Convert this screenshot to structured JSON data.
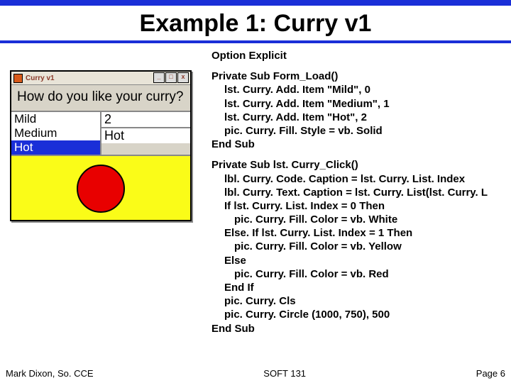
{
  "slide": {
    "title": "Example 1: Curry v1",
    "footer_left": "Mark Dixon, So. CCE",
    "footer_center": "SOFT 131",
    "footer_right": "Page 6"
  },
  "vbwindow": {
    "title": "Curry v1",
    "prompt": "How do you like your curry?",
    "list": {
      "i0": "Mild",
      "i1": "Medium",
      "i2": "Hot"
    },
    "selected_index": "2",
    "selected_text": "Hot",
    "controls": {
      "min": "_",
      "max": "□",
      "close": "x"
    }
  },
  "code": {
    "option": "Option Explicit",
    "l1": "Private Sub Form_Load()",
    "l2": "lst. Curry. Add. Item \"Mild\", 0",
    "l3": "lst. Curry. Add. Item \"Medium\", 1",
    "l4": "lst. Curry. Add. Item \"Hot\", 2",
    "l5": "pic. Curry. Fill. Style = vb. Solid",
    "l6": "End Sub",
    "l7": "Private Sub lst. Curry_Click()",
    "l8": "lbl. Curry. Code. Caption = lst. Curry. List. Index",
    "l9": "lbl. Curry. Text. Caption = lst. Curry. List(lst. Curry. L",
    "l10": "If lst. Curry. List. Index = 0 Then",
    "l11": "pic. Curry. Fill. Color = vb. White",
    "l12": "Else. If lst. Curry. List. Index = 1 Then",
    "l13": "pic. Curry. Fill. Color = vb. Yellow",
    "l14": "Else",
    "l15": "pic. Curry. Fill. Color = vb. Red",
    "l16": "End If",
    "l17": "pic. Curry. Cls",
    "l18": "pic. Curry. Circle (1000, 750), 500",
    "l19": "End Sub"
  }
}
